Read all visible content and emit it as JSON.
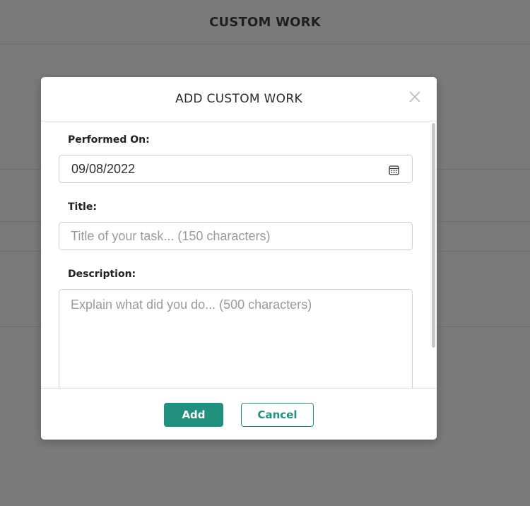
{
  "background": {
    "page_title": "CUSTOM WORK"
  },
  "modal": {
    "title": "ADD CUSTOM WORK",
    "fields": {
      "performed_on": {
        "label": "Performed On:",
        "value": "09/08/2022"
      },
      "title": {
        "label": "Title:",
        "placeholder": "Title of your task... (150 characters)"
      },
      "description": {
        "label": "Description:",
        "placeholder": "Explain what did you do... (500 characters)"
      }
    },
    "buttons": {
      "add": "Add",
      "cancel": "Cancel"
    }
  },
  "colors": {
    "accent": "#22907f",
    "overlay": "#7a7a7a"
  },
  "icons": {
    "close": "close-icon",
    "calendar": "calendar-icon"
  }
}
